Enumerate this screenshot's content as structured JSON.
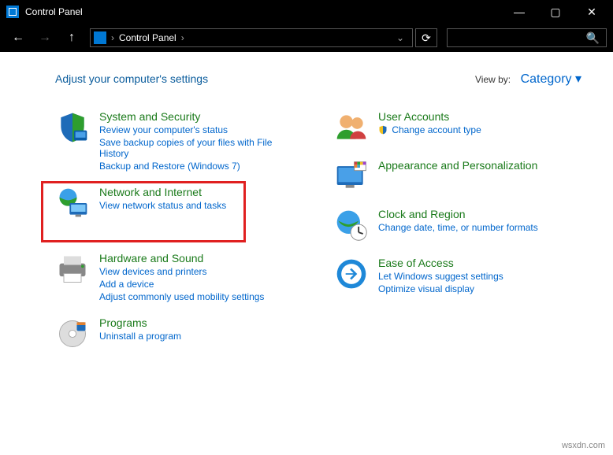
{
  "window": {
    "title": "Control Panel"
  },
  "breadcrumb": {
    "root": "Control Panel"
  },
  "heading": "Adjust your computer's settings",
  "viewby": {
    "label": "View by:",
    "value": "Category"
  },
  "left": {
    "system": {
      "title": "System and Security",
      "links": [
        "Review your computer's status",
        "Save backup copies of your files with File History",
        "Backup and Restore (Windows 7)"
      ]
    },
    "network": {
      "title": "Network and Internet",
      "links": [
        "View network status and tasks"
      ]
    },
    "hardware": {
      "title": "Hardware and Sound",
      "links": [
        "View devices and printers",
        "Add a device",
        "Adjust commonly used mobility settings"
      ]
    },
    "programs": {
      "title": "Programs",
      "links": [
        "Uninstall a program"
      ]
    }
  },
  "right": {
    "users": {
      "title": "User Accounts",
      "links": [
        "Change account type"
      ]
    },
    "appearance": {
      "title": "Appearance and Personalization"
    },
    "clock": {
      "title": "Clock and Region",
      "links": [
        "Change date, time, or number formats"
      ]
    },
    "ease": {
      "title": "Ease of Access",
      "links": [
        "Let Windows suggest settings",
        "Optimize visual display"
      ]
    }
  },
  "watermark": "wsxdn.com"
}
